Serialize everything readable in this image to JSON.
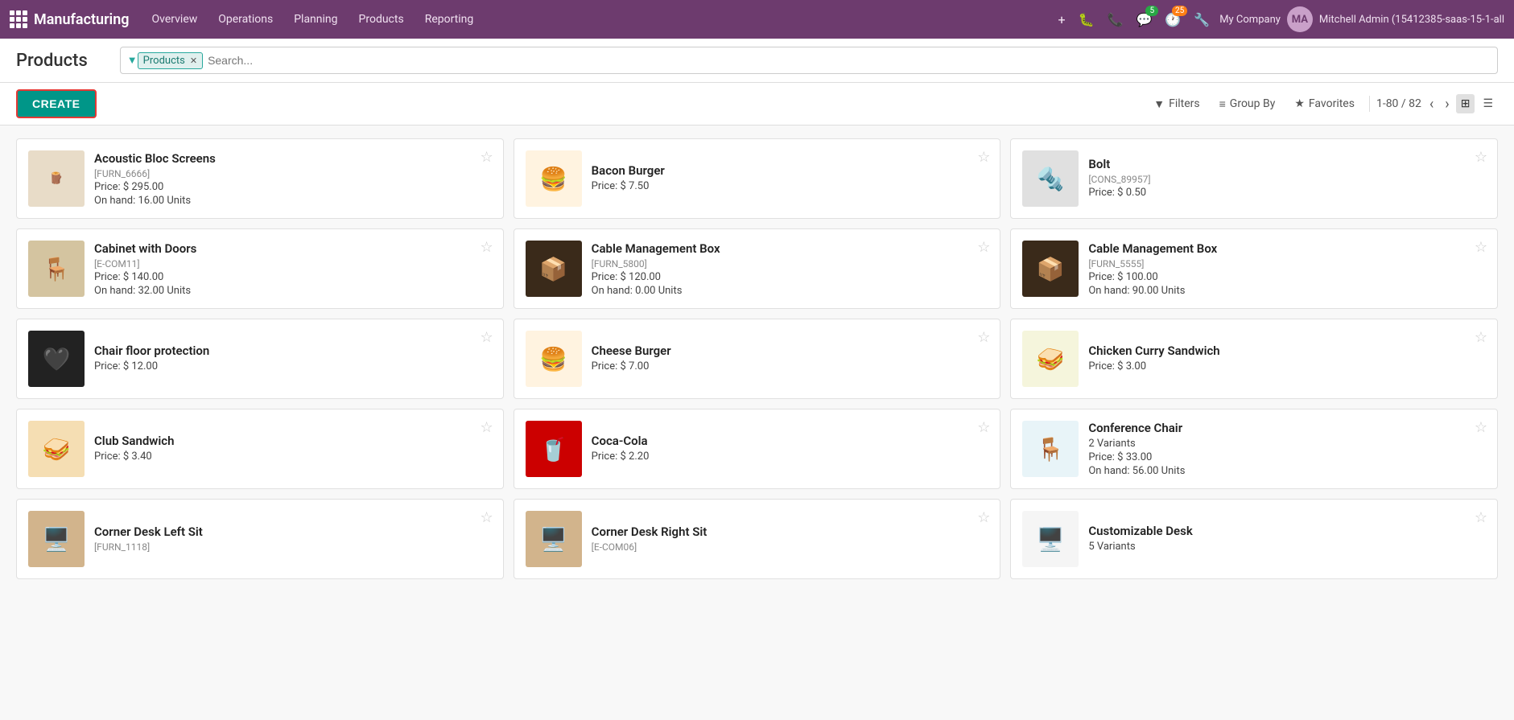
{
  "app": {
    "brand": "Manufacturing",
    "nav": [
      {
        "label": "Overview",
        "id": "overview"
      },
      {
        "label": "Operations",
        "id": "operations"
      },
      {
        "label": "Planning",
        "id": "planning"
      },
      {
        "label": "Products",
        "id": "products"
      },
      {
        "label": "Reporting",
        "id": "reporting"
      }
    ],
    "actions": {
      "add": "+",
      "bug": "🐞",
      "phone": "📞",
      "chat": "💬",
      "chat_badge": "5",
      "clock": "🕐",
      "clock_badge": "25",
      "wrench": "🔧",
      "company": "My Company",
      "username": "Mitchell Admin (15412385-saas-15-1-all"
    }
  },
  "page": {
    "title": "Products",
    "search": {
      "filter_tag": "Products",
      "placeholder": "Search..."
    },
    "toolbar": {
      "create_label": "CREATE",
      "filters_label": "Filters",
      "groupby_label": "Group By",
      "favorites_label": "Favorites",
      "pagination_text": "1-80 / 82"
    }
  },
  "products": [
    {
      "id": "acoustic-bloc",
      "name": "Acoustic Bloc Screens",
      "ref": "[FURN_6666]",
      "price": "Price: $ 295.00",
      "stock": "On hand: 16.00 Units",
      "variants": null,
      "img_class": "img-acoustic",
      "img_symbol": "🪵"
    },
    {
      "id": "bacon-burger",
      "name": "Bacon Burger",
      "ref": null,
      "price": "Price: $ 7.50",
      "stock": null,
      "variants": null,
      "img_class": "img-burger",
      "img_symbol": "🍔"
    },
    {
      "id": "bolt",
      "name": "Bolt",
      "ref": "[CONS_89957]",
      "price": "Price: $ 0.50",
      "stock": null,
      "variants": null,
      "img_class": "img-bolt",
      "img_symbol": "🔩"
    },
    {
      "id": "cabinet-doors",
      "name": "Cabinet with Doors",
      "ref": "[E-COM11]",
      "price": "Price: $ 140.00",
      "stock": "On hand: 32.00 Units",
      "variants": null,
      "img_class": "img-cabinet",
      "img_symbol": "🪑"
    },
    {
      "id": "cable-mgmt-5800",
      "name": "Cable Management Box",
      "ref": "[FURN_5800]",
      "price": "Price: $ 120.00",
      "stock": "On hand: 0.00 Units",
      "variants": null,
      "img_class": "img-cable",
      "img_symbol": "📦"
    },
    {
      "id": "cable-mgmt-5555",
      "name": "Cable Management Box",
      "ref": "[FURN_5555]",
      "price": "Price: $ 100.00",
      "stock": "On hand: 90.00 Units",
      "variants": null,
      "img_class": "img-cable2",
      "img_symbol": "📦"
    },
    {
      "id": "chair-floor-protect",
      "name": "Chair floor protection",
      "ref": null,
      "price": "Price: $ 12.00",
      "stock": null,
      "variants": null,
      "img_class": "img-chair-protect",
      "img_symbol": "🖤"
    },
    {
      "id": "cheese-burger",
      "name": "Cheese Burger",
      "ref": null,
      "price": "Price: $ 7.00",
      "stock": null,
      "variants": null,
      "img_class": "img-cheese",
      "img_symbol": "🍔"
    },
    {
      "id": "chicken-curry",
      "name": "Chicken Curry Sandwich",
      "ref": null,
      "price": "Price: $ 3.00",
      "stock": null,
      "variants": null,
      "img_class": "img-chicken",
      "img_symbol": "🥪"
    },
    {
      "id": "club-sandwich",
      "name": "Club Sandwich",
      "ref": null,
      "price": "Price: $ 3.40",
      "stock": null,
      "variants": null,
      "img_class": "img-club",
      "img_symbol": "🥪"
    },
    {
      "id": "coca-cola",
      "name": "Coca-Cola",
      "ref": null,
      "price": "Price: $ 2.20",
      "stock": null,
      "variants": null,
      "img_class": "img-coca",
      "img_symbol": "🥤"
    },
    {
      "id": "conference-chair",
      "name": "Conference Chair",
      "ref": null,
      "price": "Price: $ 33.00",
      "stock": "On hand: 56.00 Units",
      "variants": "2 Variants",
      "img_class": "img-conf-chair",
      "img_symbol": "🪑"
    },
    {
      "id": "corner-desk-left",
      "name": "Corner Desk Left Sit",
      "ref": "[FURN_1118]",
      "price": null,
      "stock": null,
      "variants": null,
      "img_class": "img-corner-desk-l",
      "img_symbol": "🖥️"
    },
    {
      "id": "corner-desk-right",
      "name": "Corner Desk Right Sit",
      "ref": "[E-COM06]",
      "price": null,
      "stock": null,
      "variants": null,
      "img_class": "img-corner-desk-r",
      "img_symbol": "🖥️"
    },
    {
      "id": "customizable-desk",
      "name": "Customizable Desk",
      "ref": null,
      "price": null,
      "stock": null,
      "variants": "5 Variants",
      "img_class": "img-custom-desk",
      "img_symbol": "🖥️"
    }
  ]
}
